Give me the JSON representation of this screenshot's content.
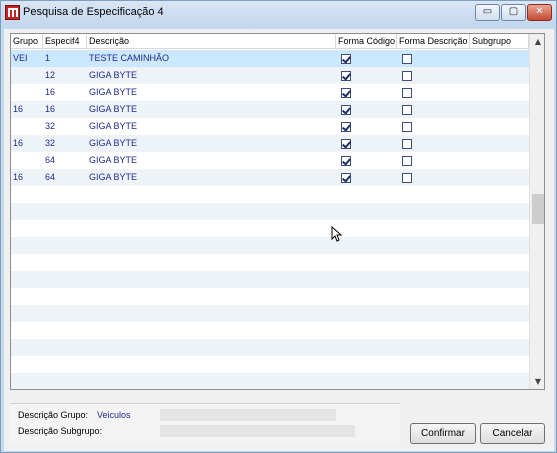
{
  "window": {
    "title": "Pesquisa de Especificação 4",
    "controls": {
      "minimize": "▭",
      "restore": "▢",
      "close": "✕"
    }
  },
  "grid": {
    "columns": [
      "Grupo",
      "Especif4",
      "Descrição",
      "Forma Código",
      "Forma Descrição",
      "Subgrupo"
    ],
    "rows": [
      {
        "grupo": "VEI",
        "especif4": "1",
        "descricao": "TESTE CAMINHÃO",
        "forma_codigo": true,
        "forma_descricao": false,
        "subgrupo": ""
      },
      {
        "grupo": "",
        "especif4": "12",
        "descricao": "GIGA BYTE",
        "forma_codigo": true,
        "forma_descricao": false,
        "subgrupo": ""
      },
      {
        "grupo": "",
        "especif4": "16",
        "descricao": "GIGA BYTE",
        "forma_codigo": true,
        "forma_descricao": false,
        "subgrupo": ""
      },
      {
        "grupo": "16",
        "especif4": "16",
        "descricao": "GIGA BYTE",
        "forma_codigo": true,
        "forma_descricao": false,
        "subgrupo": ""
      },
      {
        "grupo": "",
        "especif4": "32",
        "descricao": "GIGA BYTE",
        "forma_codigo": true,
        "forma_descricao": false,
        "subgrupo": ""
      },
      {
        "grupo": "16",
        "especif4": "32",
        "descricao": "GIGA BYTE",
        "forma_codigo": true,
        "forma_descricao": false,
        "subgrupo": ""
      },
      {
        "grupo": "",
        "especif4": "64",
        "descricao": "GIGA BYTE",
        "forma_codigo": true,
        "forma_descricao": false,
        "subgrupo": ""
      },
      {
        "grupo": "16",
        "especif4": "64",
        "descricao": "GIGA BYTE",
        "forma_codigo": true,
        "forma_descricao": false,
        "subgrupo": ""
      }
    ],
    "selected_row": 0
  },
  "info": {
    "grupo_label": "Descrição Grupo:",
    "grupo_value": "Veiculos",
    "subgrupo_label": "Descrição Subgrupo:",
    "subgrupo_value": ""
  },
  "buttons": {
    "confirm": "Confirmar",
    "cancel": "Cancelar"
  },
  "colors": {
    "accent": "#1f2a8c",
    "selection": "#cce8ff",
    "alt_row": "#eef3f8"
  }
}
